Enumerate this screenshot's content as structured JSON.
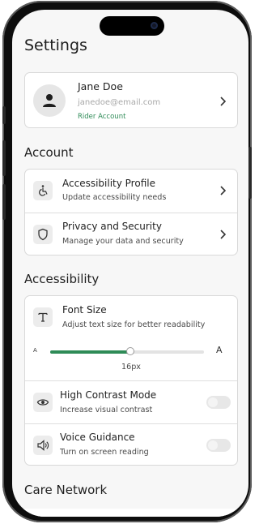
{
  "header": {
    "title": "Settings"
  },
  "profile": {
    "name": "Jane Doe",
    "email": "janedoe@email.com",
    "role": "Rider Account",
    "avatar_icon": "person-icon",
    "role_color": "#2e8b57"
  },
  "account": {
    "heading": "Account",
    "items": [
      {
        "icon": "wheelchair-icon",
        "title": "Accessibility Profile",
        "subtitle": "Update accessibility needs"
      },
      {
        "icon": "shield-icon",
        "title": "Privacy and Security",
        "subtitle": "Manage your data and security"
      }
    ]
  },
  "accessibility": {
    "heading": "Accessibility",
    "font_size": {
      "icon": "text-size-icon",
      "title": "Font Size",
      "subtitle": "Adjust text size for better readability",
      "small_label": "A",
      "large_label": "A",
      "value_label": "16px",
      "level": 0.52,
      "accent": "#2e8b57"
    },
    "toggles": [
      {
        "icon": "eye-icon",
        "title": "High Contrast Mode",
        "subtitle": "Increase visual contrast",
        "on": false
      },
      {
        "icon": "speaker-icon",
        "title": "Voice Guidance",
        "subtitle": "Turn on screen reading",
        "on": false
      }
    ]
  },
  "care_network": {
    "heading": "Care Network"
  }
}
